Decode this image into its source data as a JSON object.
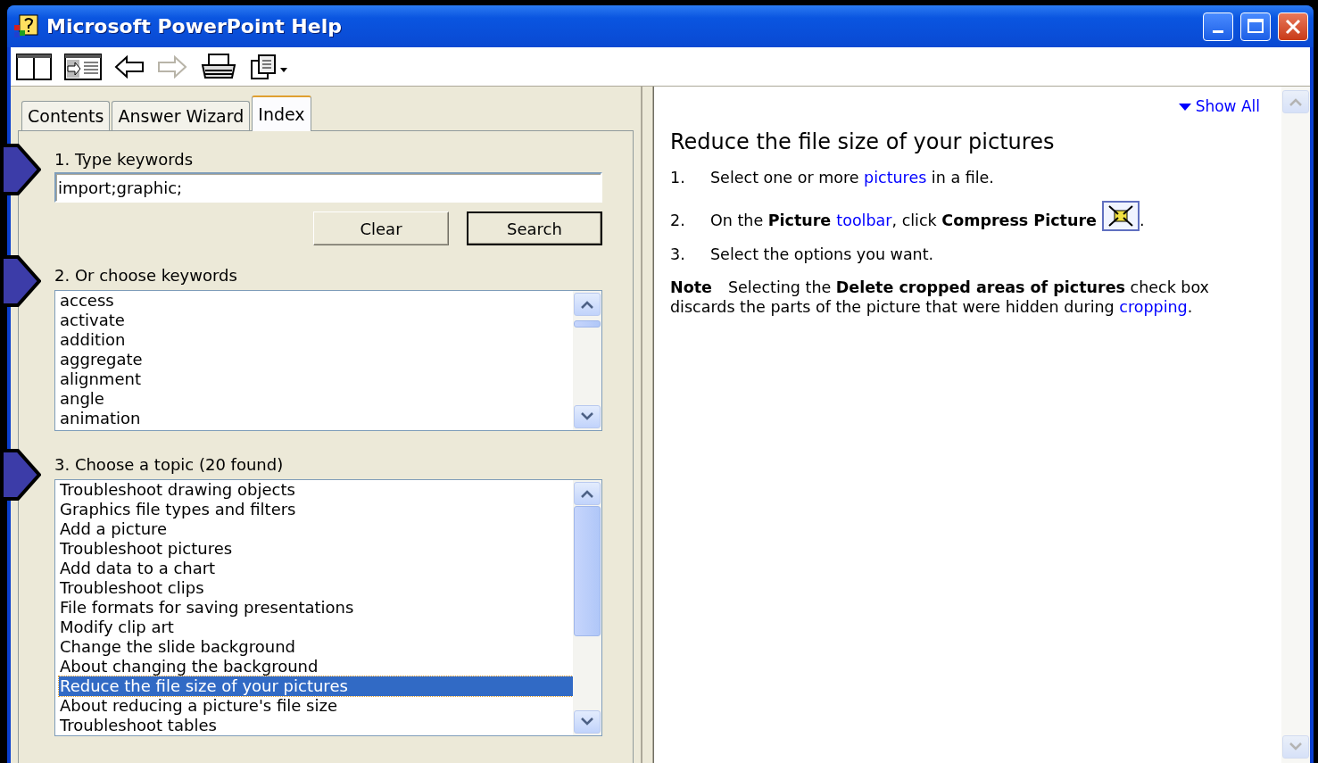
{
  "window": {
    "title": "Microsoft PowerPoint Help"
  },
  "toolbar": [
    {
      "kind": "pane",
      "disabled": false
    },
    {
      "kind": "tile",
      "disabled": false
    },
    {
      "kind": "back",
      "disabled": false
    },
    {
      "kind": "forward",
      "disabled": true
    },
    {
      "kind": "print",
      "disabled": false
    },
    {
      "kind": "options",
      "disabled": false
    }
  ],
  "tabs": [
    {
      "label": "Contents",
      "selected": false
    },
    {
      "label": "Answer Wizard",
      "selected": false
    },
    {
      "label": "Index",
      "selected": true
    }
  ],
  "keywords": {
    "label": "1. Type keywords",
    "value": "import;graphic;"
  },
  "buttons": [
    {
      "label": "Clear",
      "default": false
    },
    {
      "label": "Search",
      "default": true
    }
  ],
  "keyword_list": {
    "label": "2. Or choose keywords",
    "items": [
      "access",
      "activate",
      "addition",
      "aggregate",
      "alignment",
      "angle",
      "animation"
    ]
  },
  "topic_list": {
    "label": "3. Choose a topic (20 found)",
    "items": [
      {
        "text": "Troubleshoot drawing objects",
        "selected": false
      },
      {
        "text": "Graphics file types and filters",
        "selected": false
      },
      {
        "text": "Add a picture",
        "selected": false
      },
      {
        "text": "Troubleshoot pictures",
        "selected": false
      },
      {
        "text": "Add data to a chart",
        "selected": false
      },
      {
        "text": "Troubleshoot clips",
        "selected": false
      },
      {
        "text": "File formats for saving presentations",
        "selected": false
      },
      {
        "text": "Modify clip art",
        "selected": false
      },
      {
        "text": "Change the slide background",
        "selected": false
      },
      {
        "text": "About changing the background",
        "selected": false
      },
      {
        "text": "Reduce the file size of your pictures",
        "selected": true
      },
      {
        "text": "About reducing a picture's file size",
        "selected": false
      },
      {
        "text": "Troubleshoot tables",
        "selected": false
      }
    ]
  },
  "article": {
    "show_all": "Show All",
    "title": "Reduce the file size of your pictures",
    "steps": [
      {
        "number": "1.",
        "segments": [
          {
            "kind": "plain",
            "text": "Select one or more "
          },
          {
            "kind": "link",
            "text": "pictures"
          },
          {
            "kind": "plain",
            "text": " in a file."
          }
        ]
      },
      {
        "number": "2.",
        "segments": [
          {
            "kind": "plain",
            "text": "On the "
          },
          {
            "kind": "bold",
            "text": "Picture "
          },
          {
            "kind": "link",
            "text": "toolbar"
          },
          {
            "kind": "plain",
            "text": ", click "
          },
          {
            "kind": "bold",
            "text": "Compress Picture "
          },
          {
            "kind": "icon"
          },
          {
            "kind": "plain",
            "text": "."
          }
        ]
      },
      {
        "number": "3.",
        "segments": [
          {
            "kind": "plain",
            "text": "Select the options you want."
          }
        ]
      }
    ],
    "note": {
      "label": "Note",
      "segments": [
        {
          "kind": "plain",
          "text": "Selecting the "
        },
        {
          "kind": "bold",
          "text": "Delete cropped areas of pictures"
        },
        {
          "kind": "plain",
          "text": " check box discards the parts of the picture that were hidden during "
        },
        {
          "kind": "link",
          "text": "cropping"
        },
        {
          "kind": "plain",
          "text": "."
        }
      ]
    }
  }
}
